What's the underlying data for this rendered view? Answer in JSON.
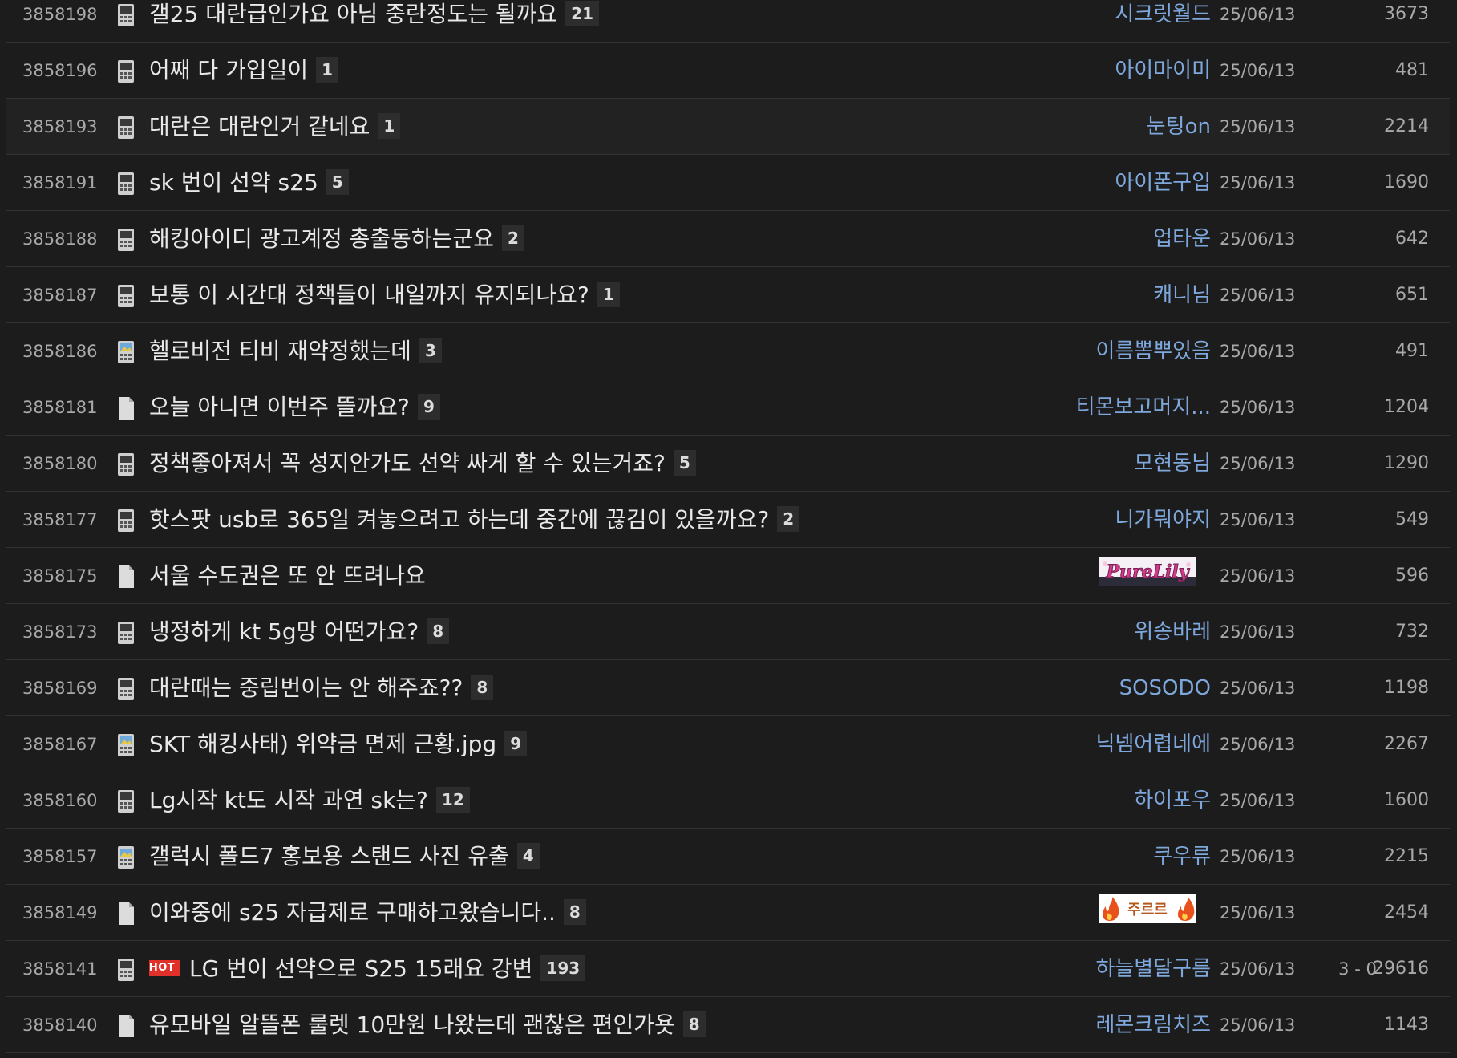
{
  "colors": {
    "background": "#1c1c1c",
    "author": "#7ea7dc",
    "hot_badge": "#e0302a",
    "comment_badge": "#2d2d2d"
  },
  "posts": [
    {
      "no": "3858198",
      "icon": "mobile-icon",
      "title": "갤25 대란급인가요 아님 중란정도는 될까요",
      "comments": "21",
      "author": "시크릿월드",
      "date": "25/06/13",
      "recommend": "",
      "views": "3673"
    },
    {
      "no": "3858196",
      "icon": "mobile-icon",
      "title": "어째 다 가입일이",
      "comments": "1",
      "author": "아이마이미",
      "date": "25/06/13",
      "recommend": "",
      "views": "481"
    },
    {
      "no": "3858193",
      "icon": "mobile-icon",
      "title": "대란은 대란인거 같네요",
      "comments": "1",
      "author": "눈팅on",
      "date": "25/06/13",
      "recommend": "",
      "views": "2214"
    },
    {
      "no": "3858191",
      "icon": "mobile-icon",
      "title": "sk 번이 선약 s25",
      "comments": "5",
      "author": "아이폰구입",
      "date": "25/06/13",
      "recommend": "",
      "views": "1690"
    },
    {
      "no": "3858188",
      "icon": "mobile-icon",
      "title": "해킹아이디 광고계정 총출동하는군요",
      "comments": "2",
      "author": "업타운",
      "date": "25/06/13",
      "recommend": "",
      "views": "642"
    },
    {
      "no": "3858187",
      "icon": "mobile-icon",
      "title": "보통 이 시간대 정책들이 내일까지 유지되나요?",
      "comments": "1",
      "author": "캐니님",
      "date": "25/06/13",
      "recommend": "",
      "views": "651"
    },
    {
      "no": "3858186",
      "icon": "mobile-photo-icon",
      "title": "헬로비전 티비 재약정했는데",
      "comments": "3",
      "author": "이름뽐뿌있음",
      "date": "25/06/13",
      "recommend": "",
      "views": "491"
    },
    {
      "no": "3858181",
      "icon": "document-icon",
      "title": "오늘 아니면 이번주 뜰까요?",
      "comments": "9",
      "author": "티몬보고머지...",
      "date": "25/06/13",
      "recommend": "",
      "views": "1204"
    },
    {
      "no": "3858180",
      "icon": "mobile-icon",
      "title": "정책좋아져서 꼭 성지안가도 선약 싸게 할 수 있는거죠?",
      "comments": "5",
      "author": "모현동님",
      "date": "25/06/13",
      "recommend": "",
      "views": "1290"
    },
    {
      "no": "3858177",
      "icon": "mobile-icon",
      "title": "핫스팟 usb로 365일 켜놓으려고 하는데 중간에 끊김이 있을까요?",
      "comments": "2",
      "author": "니가뭐야지",
      "date": "25/06/13",
      "recommend": "",
      "views": "549"
    },
    {
      "no": "3858175",
      "icon": "document-icon",
      "title": "서울 수도권은 또 안 뜨려나요",
      "comments": "",
      "author": "PureLily",
      "author_type": "image-purelily",
      "date": "25/06/13",
      "recommend": "",
      "views": "596"
    },
    {
      "no": "3858173",
      "icon": "mobile-icon",
      "title": "냉정하게 kt 5g망 어떤가요?",
      "comments": "8",
      "author": "위송바레",
      "date": "25/06/13",
      "recommend": "",
      "views": "732"
    },
    {
      "no": "3858169",
      "icon": "mobile-icon",
      "title": "대란때는 중립번이는 안 해주죠??",
      "comments": "8",
      "author": "SOSODO",
      "date": "25/06/13",
      "recommend": "",
      "views": "1198"
    },
    {
      "no": "3858167",
      "icon": "mobile-photo-icon",
      "title": "SKT 해킹사태) 위약금 면제 근황.jpg",
      "comments": "9",
      "author": "닉넴어렵네에",
      "date": "25/06/13",
      "recommend": "",
      "views": "2267"
    },
    {
      "no": "3858160",
      "icon": "mobile-icon",
      "title": "Lg시작 kt도 시작 과연 sk는?",
      "comments": "12",
      "author": "하이포우",
      "date": "25/06/13",
      "recommend": "",
      "views": "1600"
    },
    {
      "no": "3858157",
      "icon": "mobile-photo-icon",
      "title": "갤럭시 폴드7 홍보용 스탠드 사진 유출",
      "comments": "4",
      "author": "쿠우류",
      "date": "25/06/13",
      "recommend": "",
      "views": "2215"
    },
    {
      "no": "3858149",
      "icon": "document-icon",
      "title": "이와중에 s25 자급제로 구매하고왔습니다..",
      "comments": "8",
      "author": "주르르",
      "author_type": "image-fire",
      "date": "25/06/13",
      "recommend": "",
      "views": "2454"
    },
    {
      "no": "3858141",
      "icon": "mobile-icon",
      "hot": "HOT",
      "title": "LG 번이 선약으로 S25 15래요 강변",
      "comments": "193",
      "author": "하늘별달구름",
      "date": "25/06/13",
      "recommend": "3 - 0",
      "views": "29616"
    },
    {
      "no": "3858140",
      "icon": "document-icon",
      "title": "유모바일 알뜰폰 룰렛 10만원 나왔는데 괜찮은 편인가욧",
      "comments": "8",
      "author": "레몬크림치즈",
      "date": "25/06/13",
      "recommend": "",
      "views": "1143"
    }
  ]
}
